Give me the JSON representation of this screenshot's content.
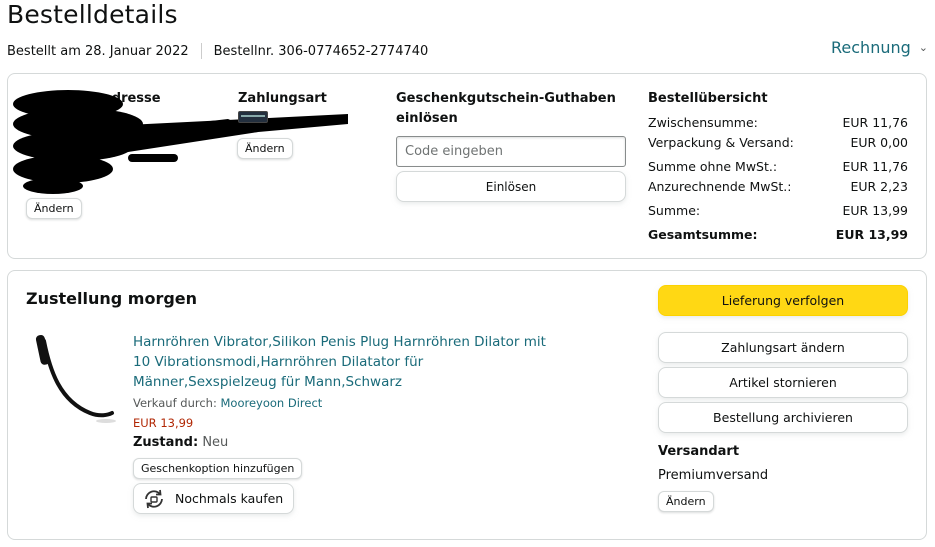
{
  "header": {
    "title": "Bestelldetails",
    "ordered_on": "Bestellt am 28. Januar 2022",
    "order_number": "Bestellnr. 306-0774652-2774740",
    "invoice_label": "Rechnung"
  },
  "summary_box": {
    "address_heading": "…adresse",
    "address_change": "Ändern",
    "payment_heading": "Zahlungsart",
    "payment_change": "Ändern",
    "giftcard_heading_line1": "Geschenkgutschein-Guthaben",
    "giftcard_heading_line2": "einlösen",
    "code_placeholder": "Code eingeben",
    "redeem_label": "Einlösen",
    "overview_heading": "Bestellübersicht",
    "rows": [
      {
        "label": "Zwischensumme:",
        "value": "EUR 11,76"
      },
      {
        "label": "Verpackung & Versand:",
        "value": "EUR 0,00"
      },
      {
        "label": "Summe ohne MwSt.:",
        "value": "EUR 11,76"
      },
      {
        "label": "Anzurechnende MwSt.:",
        "value": "EUR 2,23"
      },
      {
        "label": "Summe:",
        "value": "EUR 13,99"
      },
      {
        "label": "Gesamtsumme:",
        "value": "EUR 13,99"
      }
    ]
  },
  "delivery": {
    "title": "Zustellung morgen",
    "product_title": "Harnröhren Vibrator,Silikon Penis Plug Harnröhren Dilator mit 10 Vibrationsmodi,Harnröhren Dilatator für Männer,Sexspielzeug für Mann,Schwarz",
    "sold_by_prefix": "Verkauf durch: ",
    "seller_name": "Mooreyoon Direct",
    "price": "EUR 13,99",
    "condition_label": "Zustand:",
    "condition_value": "Neu",
    "gift_option": "Geschenkoption hinzufügen",
    "buy_again": "Nochmals kaufen",
    "actions": {
      "track": "Lieferung verfolgen",
      "change_payment": "Zahlungsart ändern",
      "cancel": "Artikel stornieren",
      "archive": "Bestellung archivieren"
    },
    "shipping_heading": "Versandart",
    "shipping_value": "Premiumversand",
    "shipping_change": "Ändern"
  },
  "colors": {
    "link": "#1a6b7a",
    "primary_button": "#ffd814",
    "price": "#b12704",
    "border": "#d5d9d9"
  }
}
